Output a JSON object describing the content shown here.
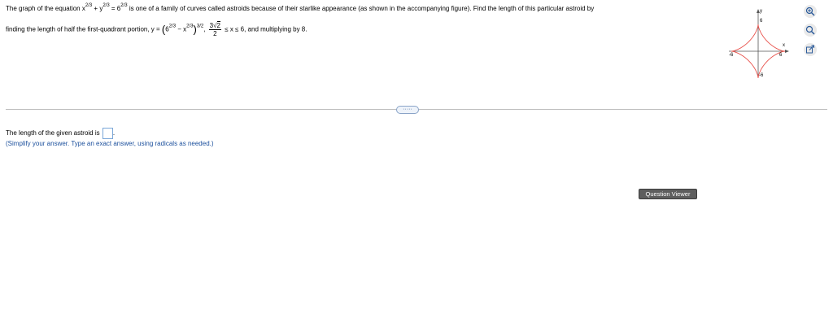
{
  "question": {
    "intro": "The graph of the equation",
    "eq_x": "x",
    "eq_exp1": "2/3",
    "eq_plus": " + ",
    "eq_y": "y",
    "eq_exp2": "2/3",
    "eq_equals": " = 6",
    "eq_exp3": "2/3",
    "middle": "is one of a family of curves called astroids because of their starlike appearance (as shown in the accompanying figure). Find the length of this particular astroid by",
    "line2_start": "finding the length of half the first-quadrant portion, y = ",
    "paren_open": "(",
    "base6": "6",
    "exp6": "2/3",
    "minus": " − x",
    "expx": "2/3",
    "paren_close": ")",
    "outer_exp": "3/2",
    "comma": ",",
    "frac_num": "3√2",
    "frac_den": "2",
    "frac_num_coef": "3",
    "frac_num_radicand": "2",
    "range": "≤ x ≤ 6, and multiplying by 8."
  },
  "more_button": "·····",
  "answer": {
    "prompt": "The length of the given astroid is",
    "end": ".",
    "hint": "(Simplify your answer. Type an exact answer, using radicals as needed.)"
  },
  "question_viewer_label": "Question Viewer",
  "figure": {
    "y_axis_label": "y",
    "x_axis_label": "x",
    "top_label": "6",
    "bottom_label": "-6",
    "left_label": "-6",
    "right_label": "6",
    "curve_color": "#e8504a"
  },
  "tools": [
    "zoom-in-icon",
    "zoom-out-icon",
    "popout-icon"
  ]
}
